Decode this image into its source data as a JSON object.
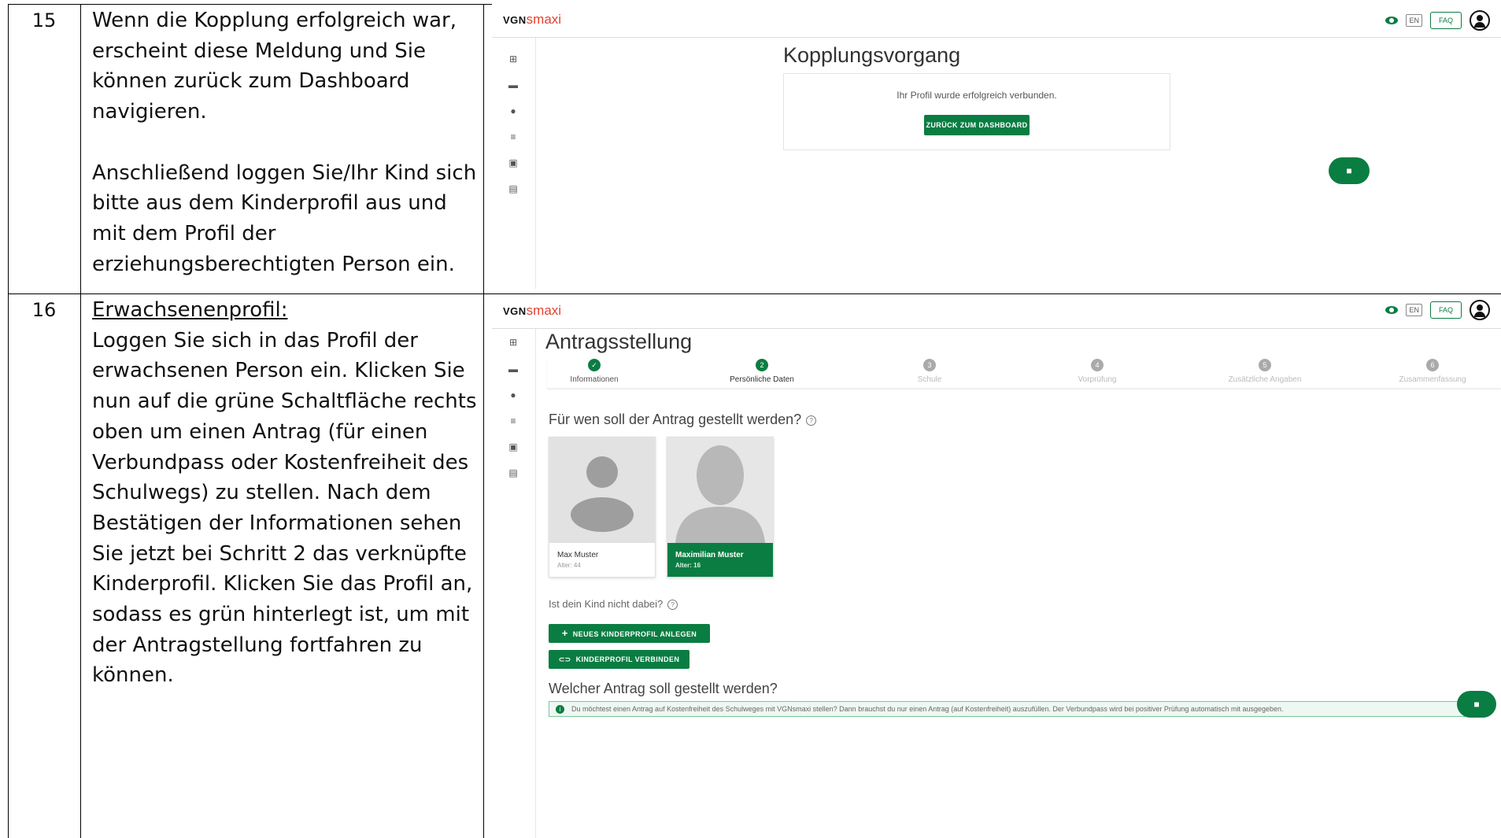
{
  "rows": [
    {
      "step": "15",
      "instruction_paragraphs": [
        "Wenn die Kopplung erfolgreich war, erscheint diese Meldung und Sie können zurück zum Dashboard navigieren.",
        "Anschließend loggen Sie/Ihr Kind sich bitte aus dem Kinderprofil aus und mit dem Profil der erziehungsberechtigten Person ein."
      ]
    },
    {
      "step": "16",
      "heading": "Erwachsenenprofil:",
      "instruction": "Loggen Sie sich in das Profil der erwachsenen Person ein. Klicken Sie nun auf die grüne Schaltfläche rechts oben um einen Antrag (für einen Verbundpass oder Kostenfreiheit des Schulwegs) zu stellen. Nach dem Bestätigen der Informationen sehen Sie jetzt bei Schritt 2 das verknüpfte Kinderprofil. Klicken Sie das Profil an, sodass es grün hinterlegt ist, um mit der Antragstellung fortfahren zu können."
    }
  ],
  "app": {
    "logo_vgn": "VGN",
    "logo_smaxi": "smaxi",
    "en_label": "EN",
    "faq_label": "FAQ",
    "brand_color": "#0a7d42",
    "accent_color": "#e5412d"
  },
  "screen1": {
    "title": "Kopplungsvorgang",
    "message": "Ihr Profil wurde erfolgreich verbunden.",
    "button": "ZURÜCK ZUM DASHBOARD"
  },
  "screen2": {
    "title": "Antragsstellung",
    "steps": [
      {
        "num": "✓",
        "label": "Informationen",
        "state": "done"
      },
      {
        "num": "2",
        "label": "Persönliche Daten",
        "state": "active"
      },
      {
        "num": "3",
        "label": "Schule",
        "state": "pending"
      },
      {
        "num": "4",
        "label": "Vorprüfung",
        "state": "pending"
      },
      {
        "num": "5",
        "label": "Zusätzliche Angaben",
        "state": "pending"
      },
      {
        "num": "6",
        "label": "Zusammenfassung",
        "state": "pending"
      }
    ],
    "question1": "Für wen soll der Antrag gestellt werden?",
    "profiles": [
      {
        "name": "Max Muster",
        "age": "Alter: 44",
        "selected": false
      },
      {
        "name": "Maximilian Muster",
        "age": "Alter: 16",
        "selected": true
      }
    ],
    "question2": "Ist dein Kind nicht dabei?",
    "btn_new": "NEUES KINDERPROFIL ANLEGEN",
    "btn_connect": "KINDERPROFIL VERBINDEN",
    "question3": "Welcher Antrag soll gestellt werden?",
    "info": "Du möchtest einen Antrag auf Kostenfreiheit des Schulweges mit VGNsmaxi stellen? Dann brauchst du nur einen Antrag (auf Kostenfreiheit) auszufüllen. Der Verbundpass wird bei positiver Prüfung automatisch mit ausgegeben."
  }
}
